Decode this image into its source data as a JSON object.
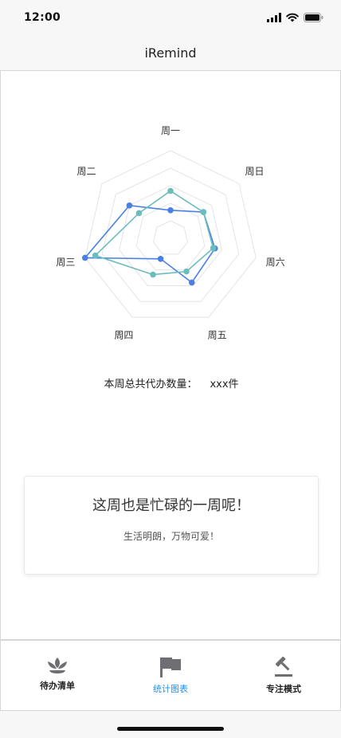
{
  "status_bar": {
    "time": "12:00"
  },
  "nav": {
    "title": "iRemind"
  },
  "chart_data": {
    "type": "radar",
    "axes": [
      "周一",
      "周日",
      "周六",
      "周五",
      "周四",
      "周三",
      "周二"
    ],
    "max": 5,
    "series": [
      {
        "color": "#4a80e6",
        "values": [
          1.6,
          2.4,
          2.6,
          2.8,
          1.3,
          5.0,
          3.0
        ]
      },
      {
        "color": "#6bbdbd",
        "values": [
          2.7,
          2.4,
          2.5,
          2.1,
          2.3,
          4.4,
          2.3
        ]
      }
    ],
    "grid_levels": 5
  },
  "summary": {
    "label": "本周总共代办数量：",
    "value": "xxx件"
  },
  "card": {
    "title": "这周也是忙碌的一周呢！",
    "subtitle": "生活明朗，万物可爱！"
  },
  "tabs": [
    {
      "label": "待办清单",
      "icon": "lotus-icon",
      "active": false
    },
    {
      "label": "统计图表",
      "icon": "flag-icon",
      "active": true
    },
    {
      "label": "专注模式",
      "icon": "gavel-icon",
      "active": false
    }
  ],
  "colors": {
    "accent": "#1f8ff0",
    "series1": "#4a80e6",
    "series2": "#6bbdbd",
    "icon": "#6f6f73"
  }
}
